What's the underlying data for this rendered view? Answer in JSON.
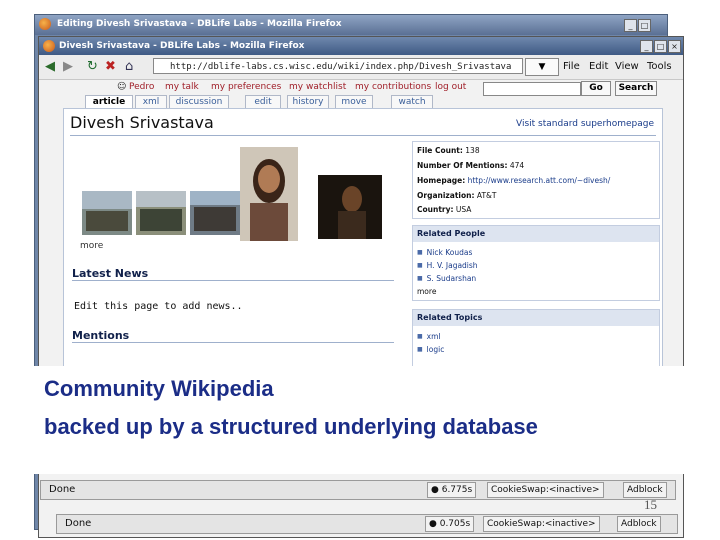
{
  "back_window": {
    "title": "Editing Divesh Srivastava - DBLife Labs - Mozilla Firefox"
  },
  "front_window": {
    "title": "Divesh Srivastava - DBLife Labs - Mozilla Firefox"
  },
  "navbar": {
    "url": "http://dblife-labs.cs.wisc.edu/wiki/index.php/Divesh_Srivastava",
    "go_label": "",
    "menus": [
      "File",
      "Edit",
      "View",
      "Tools"
    ]
  },
  "wiki": {
    "user_links": [
      "Pedro",
      "my talk",
      "my preferences",
      "my watchlist",
      "my contributions",
      "log out"
    ],
    "go_label": "Go",
    "search_label": "Search",
    "tabs": [
      "article",
      "xml",
      "discussion",
      "edit",
      "history",
      "move",
      "watch"
    ]
  },
  "article": {
    "title": "Divesh Srivastava",
    "visit_link": "Visit standard superhomepage",
    "more_photos": "more",
    "latest_news_heading": "Latest News",
    "news_text": "Edit this page to add news..",
    "mentions_heading": "Mentions"
  },
  "infobox": {
    "file_count_label": "File Count:",
    "file_count": "138",
    "mentions_label": "Number Of Mentions:",
    "mentions": "474",
    "homepage_label": "Homepage:",
    "homepage": "http://www.research.att.com/~divesh/",
    "organization_label": "Organization:",
    "organization": "AT&T",
    "country_label": "Country:",
    "country": "USA"
  },
  "related_people": {
    "heading": "Related People",
    "items": [
      "Nick Koudas",
      "H. V. Jagadish",
      "S. Sudarshan"
    ],
    "more": "more"
  },
  "related_topics": {
    "heading": "Related Topics",
    "items": [
      "xml",
      "logic"
    ]
  },
  "caption": {
    "line1": "Community Wikipedia",
    "line2": "backed up by a structured underlying database"
  },
  "status_back": {
    "done": "Done",
    "time": "6.775s",
    "cookie": "CookieSwap:<inactive>",
    "adblock": "Adblock"
  },
  "status_front": {
    "done": "Done",
    "time": "0.705s",
    "cookie": "CookieSwap:<inactive>",
    "adblock": "Adblock"
  },
  "page_number": "15"
}
